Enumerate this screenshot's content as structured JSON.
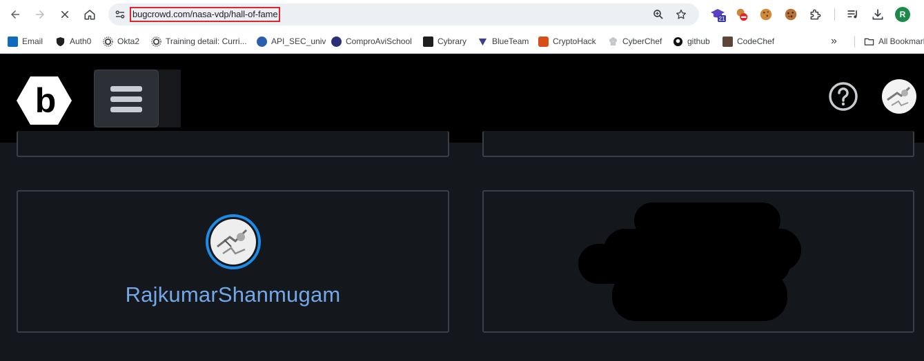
{
  "browser": {
    "url": "bugcrowd.com/nasa-vdp/hall-of-fame",
    "profile_initial": "R",
    "extension_badge": "21"
  },
  "bookmarks": [
    {
      "label": "Email",
      "icon": "outlook-icon",
      "color": "#0f6cbd"
    },
    {
      "label": "Auth0",
      "icon": "auth0-shield-icon",
      "color": "#1f1f1f"
    },
    {
      "label": "Okta2",
      "icon": "okta-sunburst-icon",
      "color": "#444"
    },
    {
      "label": "Training detail: Curri...",
      "icon": "okta-sunburst-icon",
      "color": "#444"
    },
    {
      "label": "API_SEC_univ",
      "icon": "apisec-icon",
      "color": "#2a5fb0"
    },
    {
      "label": "ComproAviSchool",
      "icon": "compro-icon",
      "color": "#2b2f7a"
    },
    {
      "label": "Cybrary",
      "icon": "cybrary-icon",
      "color": "#1e1e1e"
    },
    {
      "label": "BlueTeam",
      "icon": "blueteam-icon",
      "color": "#3b3f8c"
    },
    {
      "label": "CryptoHack",
      "icon": "cryptohack-icon",
      "color": "#d84e1b"
    },
    {
      "label": "CyberChef",
      "icon": "chef-hat-icon",
      "color": "#9aa0a6"
    },
    {
      "label": "github",
      "icon": "github-icon",
      "color": "#111"
    },
    {
      "label": "CodeChef",
      "icon": "codechef-icon",
      "color": "#5b4638"
    }
  ],
  "bookmarks_overflow": "»",
  "all_bookmarks": "All Bookmarks",
  "site": {
    "logo_letter": "b",
    "help_icon": "question-circle-icon"
  },
  "hall_of_fame": {
    "hunter_name": "RajkumarShanmugam",
    "accent_color": "#73a8e8",
    "avatar_ring_color": "#1c8ce6"
  }
}
